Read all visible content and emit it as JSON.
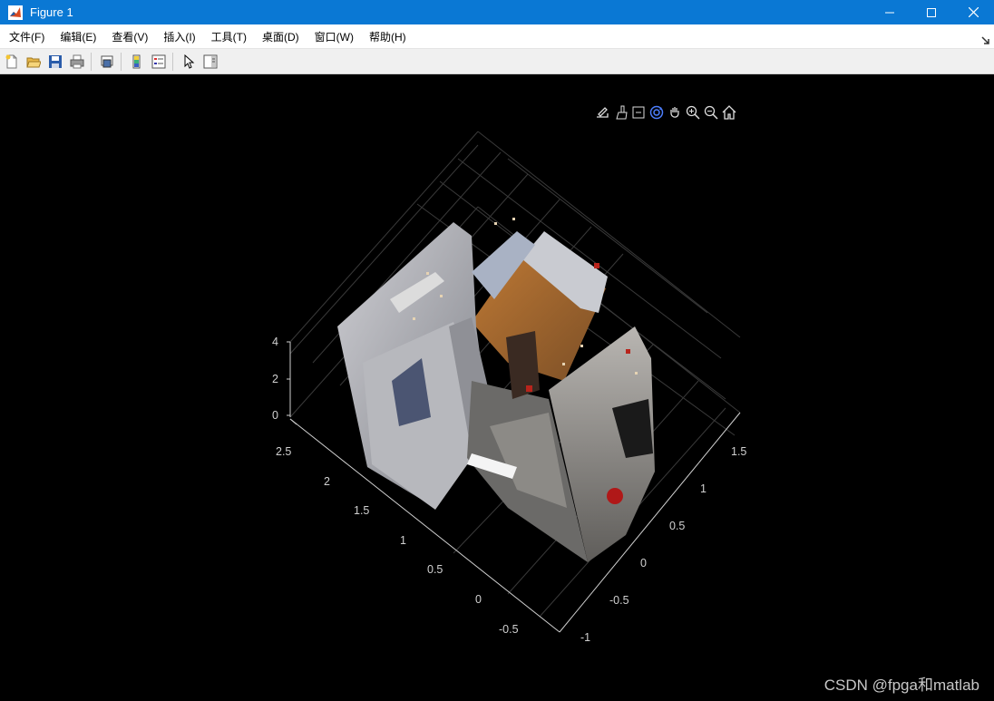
{
  "window": {
    "title": "Figure 1",
    "buttons": [
      "minimize",
      "maximize",
      "close"
    ]
  },
  "menubar": {
    "items": [
      {
        "label": "文件(F)"
      },
      {
        "label": "编辑(E)"
      },
      {
        "label": "查看(V)"
      },
      {
        "label": "插入(I)"
      },
      {
        "label": "工具(T)"
      },
      {
        "label": "桌面(D)"
      },
      {
        "label": "窗口(W)"
      },
      {
        "label": "帮助(H)"
      }
    ]
  },
  "toolbar": {
    "icons": [
      "new-figure-icon",
      "open-file-icon",
      "save-icon",
      "print-icon",
      "print-preview-icon",
      "colorbar-icon",
      "legend-icon",
      "edit-plot-icon",
      "property-inspector-icon"
    ]
  },
  "axes_toolbar": {
    "icons": [
      "export-icon",
      "brush-icon",
      "data-tips-icon",
      "rotate-3d-icon",
      "pan-icon",
      "zoom-in-icon",
      "zoom-out-icon",
      "home-icon"
    ],
    "active": "rotate-3d-icon",
    "active_color": "#4d7fff"
  },
  "chart_data": {
    "type": "scatter",
    "description_kind": "3D point cloud",
    "z_ticks": [
      "0",
      "2",
      "4"
    ],
    "x_ticks": [
      "-0.5",
      "0",
      "0.5",
      "1",
      "1.5",
      "2",
      "2.5"
    ],
    "y_ticks": [
      "-1",
      "-0.5",
      "0",
      "0.5",
      "1",
      "1.5"
    ],
    "axis_color": "#d0d0d0",
    "grid": true,
    "background": "#000000"
  },
  "watermark": "CSDN @fpga和matlab",
  "colors": {
    "titlebar": "#0a78d4",
    "accent": "#4d7fff"
  }
}
